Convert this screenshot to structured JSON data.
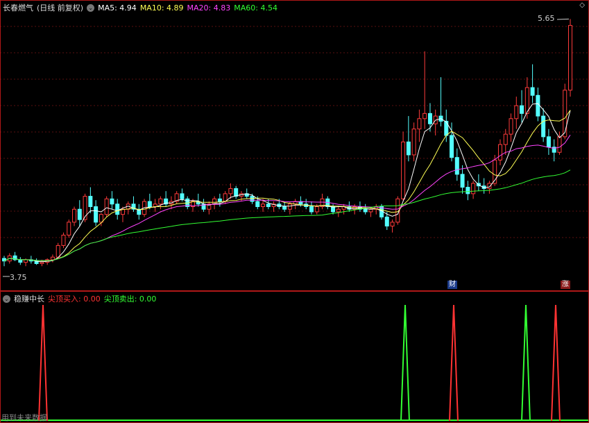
{
  "main_header": {
    "stock_name": "长春燃气",
    "period": "(日线 前复权)",
    "ma": [
      {
        "label": "MA5: 4.94",
        "color": "#ffffff"
      },
      {
        "label": "MA10: 4.89",
        "color": "#ffff55"
      },
      {
        "label": "MA20: 4.83",
        "color": "#ff44ff"
      },
      {
        "label": "MA60: 4.54",
        "color": "#33ff33"
      }
    ]
  },
  "price_labels": {
    "high": "5.65",
    "low": "3.75"
  },
  "badges": {
    "cai": "财",
    "zhang": "涨"
  },
  "indicator_header": {
    "name": "稳赚中长",
    "buy_label": "尖顶买入: 0.00",
    "sell_label": "尖顶卖出: 0.00"
  },
  "footer_text": "用到未来数据",
  "chart_data": {
    "type": "candlestick",
    "ylim": [
      3.65,
      5.7
    ],
    "candles": [
      [
        3.8,
        3.82,
        3.74,
        3.78
      ],
      [
        3.78,
        3.84,
        3.76,
        3.82
      ],
      [
        3.82,
        3.85,
        3.78,
        3.79
      ],
      [
        3.79,
        3.81,
        3.75,
        3.77
      ],
      [
        3.77,
        3.8,
        3.74,
        3.79
      ],
      [
        3.79,
        3.82,
        3.76,
        3.78
      ],
      [
        3.78,
        3.8,
        3.75,
        3.76
      ],
      [
        3.76,
        3.79,
        3.74,
        3.77
      ],
      [
        3.77,
        3.8,
        3.75,
        3.79
      ],
      [
        3.79,
        3.83,
        3.77,
        3.81
      ],
      [
        3.81,
        3.92,
        3.8,
        3.9
      ],
      [
        3.9,
        4.0,
        3.88,
        3.98
      ],
      [
        3.98,
        4.1,
        3.96,
        4.08
      ],
      [
        4.08,
        4.2,
        4.05,
        4.18
      ],
      [
        4.18,
        4.25,
        4.05,
        4.1
      ],
      [
        4.1,
        4.3,
        4.08,
        4.28
      ],
      [
        4.28,
        4.35,
        4.15,
        4.2
      ],
      [
        4.2,
        4.25,
        4.05,
        4.08
      ],
      [
        4.08,
        4.15,
        4.05,
        4.14
      ],
      [
        4.14,
        4.28,
        4.12,
        4.26
      ],
      [
        4.26,
        4.32,
        4.18,
        4.22
      ],
      [
        4.22,
        4.26,
        4.1,
        4.14
      ],
      [
        4.14,
        4.2,
        4.08,
        4.18
      ],
      [
        4.18,
        4.24,
        4.14,
        4.22
      ],
      [
        4.22,
        4.28,
        4.16,
        4.18
      ],
      [
        4.18,
        4.22,
        4.1,
        4.14
      ],
      [
        4.14,
        4.26,
        4.12,
        4.24
      ],
      [
        4.24,
        4.3,
        4.18,
        4.2
      ],
      [
        4.2,
        4.26,
        4.16,
        4.22
      ],
      [
        4.22,
        4.28,
        4.18,
        4.26
      ],
      [
        4.26,
        4.32,
        4.2,
        4.22
      ],
      [
        4.22,
        4.28,
        4.18,
        4.24
      ],
      [
        4.24,
        4.32,
        4.22,
        4.3
      ],
      [
        4.3,
        4.34,
        4.24,
        4.26
      ],
      [
        4.26,
        4.28,
        4.18,
        4.2
      ],
      [
        4.2,
        4.26,
        4.16,
        4.24
      ],
      [
        4.24,
        4.3,
        4.2,
        4.22
      ],
      [
        4.22,
        4.26,
        4.16,
        4.18
      ],
      [
        4.18,
        4.24,
        4.14,
        4.22
      ],
      [
        4.22,
        4.28,
        4.18,
        4.26
      ],
      [
        4.26,
        4.3,
        4.2,
        4.24
      ],
      [
        4.24,
        4.32,
        4.22,
        4.3
      ],
      [
        4.3,
        4.38,
        4.26,
        4.34
      ],
      [
        4.34,
        4.36,
        4.26,
        4.28
      ],
      [
        4.28,
        4.32,
        4.24,
        4.3
      ],
      [
        4.3,
        4.34,
        4.26,
        4.28
      ],
      [
        4.28,
        4.3,
        4.22,
        4.24
      ],
      [
        4.24,
        4.28,
        4.18,
        4.2
      ],
      [
        4.2,
        4.26,
        4.16,
        4.22
      ],
      [
        4.22,
        4.26,
        4.18,
        4.2
      ],
      [
        4.2,
        4.24,
        4.16,
        4.22
      ],
      [
        4.22,
        4.26,
        4.18,
        4.2
      ],
      [
        4.2,
        4.24,
        4.16,
        4.18
      ],
      [
        4.18,
        4.24,
        4.14,
        4.22
      ],
      [
        4.22,
        4.26,
        4.18,
        4.24
      ],
      [
        4.24,
        4.28,
        4.2,
        4.22
      ],
      [
        4.22,
        4.26,
        4.18,
        4.2
      ],
      [
        4.2,
        4.24,
        4.14,
        4.16
      ],
      [
        4.16,
        4.22,
        4.14,
        4.2
      ],
      [
        4.2,
        4.3,
        4.18,
        4.26
      ],
      [
        4.26,
        4.28,
        4.18,
        4.2
      ],
      [
        4.2,
        4.22,
        4.14,
        4.16
      ],
      [
        4.16,
        4.2,
        4.12,
        4.18
      ],
      [
        4.18,
        4.22,
        4.14,
        4.2
      ],
      [
        4.2,
        4.24,
        4.16,
        4.18
      ],
      [
        4.18,
        4.22,
        4.14,
        4.2
      ],
      [
        4.2,
        4.24,
        4.16,
        4.18
      ],
      [
        4.18,
        4.22,
        4.14,
        4.16
      ],
      [
        4.16,
        4.2,
        4.12,
        4.18
      ],
      [
        4.18,
        4.22,
        4.14,
        4.2
      ],
      [
        4.2,
        4.22,
        4.1,
        4.12
      ],
      [
        4.12,
        4.16,
        4.02,
        4.05
      ],
      [
        4.05,
        4.1,
        4.0,
        4.08
      ],
      [
        4.08,
        4.28,
        4.06,
        4.26
      ],
      [
        4.26,
        4.78,
        4.24,
        4.7
      ],
      [
        4.7,
        4.9,
        4.55,
        4.6
      ],
      [
        4.6,
        4.85,
        4.55,
        4.8
      ],
      [
        4.8,
        4.95,
        4.7,
        4.88
      ],
      [
        4.88,
        5.4,
        4.8,
        4.92
      ],
      [
        4.92,
        5.0,
        4.78,
        4.84
      ],
      [
        4.84,
        4.95,
        4.75,
        4.9
      ],
      [
        4.9,
        5.2,
        4.82,
        4.86
      ],
      [
        4.86,
        4.95,
        4.7,
        4.75
      ],
      [
        4.75,
        4.85,
        4.55,
        4.58
      ],
      [
        4.58,
        4.65,
        4.4,
        4.45
      ],
      [
        4.45,
        4.52,
        4.3,
        4.35
      ],
      [
        4.35,
        4.4,
        4.25,
        4.3
      ],
      [
        4.3,
        4.4,
        4.26,
        4.38
      ],
      [
        4.38,
        4.45,
        4.32,
        4.36
      ],
      [
        4.36,
        4.42,
        4.3,
        4.34
      ],
      [
        4.34,
        4.4,
        4.3,
        4.38
      ],
      [
        4.38,
        4.6,
        4.36,
        4.56
      ],
      [
        4.56,
        4.72,
        4.52,
        4.68
      ],
      [
        4.68,
        4.8,
        4.6,
        4.76
      ],
      [
        4.76,
        4.92,
        4.7,
        4.88
      ],
      [
        4.88,
        5.05,
        4.8,
        4.98
      ],
      [
        4.98,
        5.1,
        4.85,
        4.92
      ],
      [
        4.92,
        5.2,
        4.88,
        5.12
      ],
      [
        5.12,
        5.3,
        5.0,
        5.06
      ],
      [
        5.06,
        5.12,
        4.86,
        4.9
      ],
      [
        4.9,
        4.96,
        4.7,
        4.74
      ],
      [
        4.74,
        4.8,
        4.6,
        4.66
      ],
      [
        4.66,
        4.72,
        4.55,
        4.62
      ],
      [
        4.62,
        4.78,
        4.6,
        4.74
      ],
      [
        4.74,
        5.15,
        4.72,
        5.1
      ],
      [
        5.1,
        5.65,
        5.05,
        5.6
      ]
    ]
  }
}
